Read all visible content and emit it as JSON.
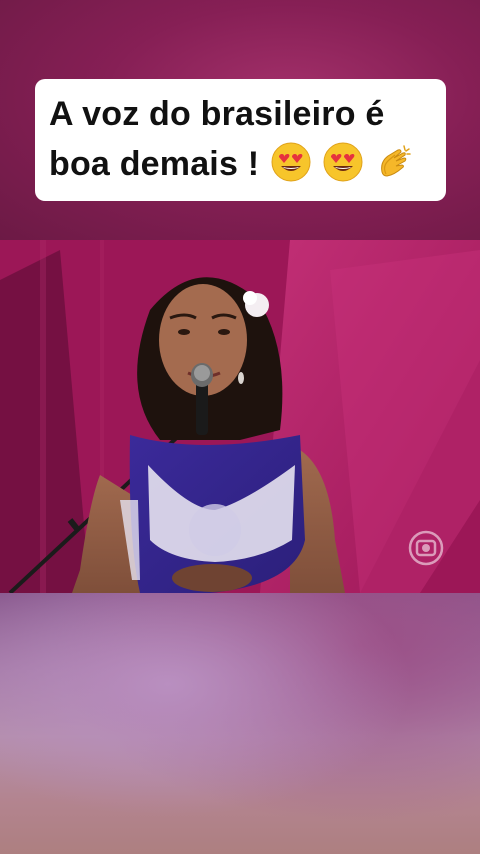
{
  "caption": {
    "line1": "A voz do brasileiro é",
    "line2": "boa demais !",
    "emojis": [
      "heart-eyes-emoji",
      "heart-eyes-emoji",
      "clapping-hands-emoji"
    ]
  },
  "video": {
    "description_icon": "singer-with-microphone",
    "watermark_icon": "globo-logo-icon"
  },
  "colors": {
    "background": "#861f55",
    "caption_bg": "#ffffff",
    "caption_text": "#111111",
    "stage": "#b51f67"
  }
}
